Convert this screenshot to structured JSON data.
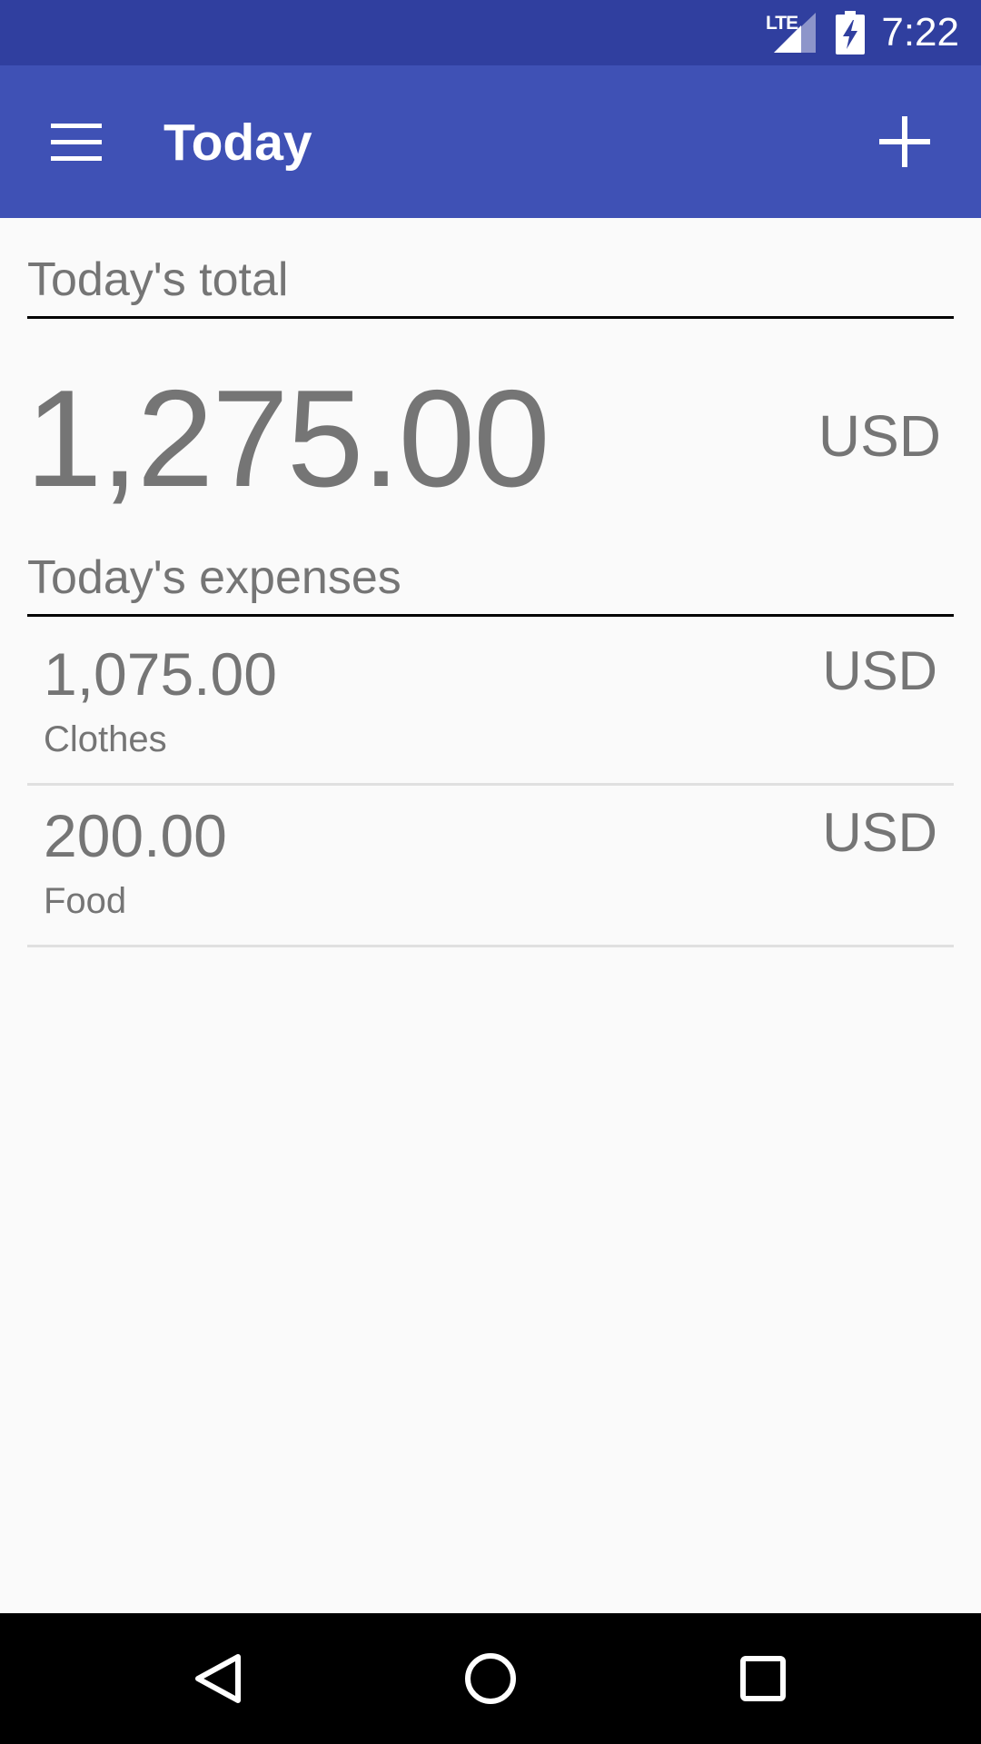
{
  "status_bar": {
    "network": "LTE",
    "time": "7:22"
  },
  "app_bar": {
    "title": "Today"
  },
  "summary": {
    "section_title": "Today's total",
    "total": "1,275.00",
    "currency": "USD"
  },
  "expenses": {
    "section_title": "Today's expenses",
    "items": [
      {
        "amount": "1,075.00",
        "category": "Clothes",
        "currency": "USD"
      },
      {
        "amount": "200.00",
        "category": "Food",
        "currency": "USD"
      }
    ]
  },
  "colors": {
    "status_bar": "#303f9f",
    "app_bar": "#3f51b5",
    "background": "#fafafa",
    "text_secondary": "#757575"
  },
  "icons": {
    "menu": "hamburger-menu-icon",
    "add": "plus-icon",
    "signal": "signal-icon",
    "battery": "battery-charging-icon",
    "back": "back-triangle-icon",
    "home": "home-circle-icon",
    "recents": "recents-square-icon"
  }
}
